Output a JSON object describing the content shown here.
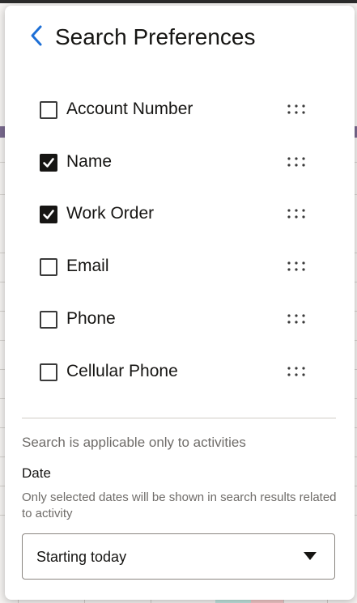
{
  "panel": {
    "title": "Search Preferences",
    "accent_color": "#1d6fd6"
  },
  "fields": [
    {
      "label": "Account Number",
      "checked": false
    },
    {
      "label": "Name",
      "checked": true
    },
    {
      "label": "Work Order",
      "checked": true
    },
    {
      "label": "Email",
      "checked": false
    },
    {
      "label": "Phone",
      "checked": false
    },
    {
      "label": "Cellular Phone",
      "checked": false
    }
  ],
  "activity_note": "Search is applicable only to activities",
  "date": {
    "label": "Date",
    "help_text": "Only selected dates will be shown in search results related to activity",
    "selected": "Starting today"
  },
  "icons": {
    "back": "chevron-left-icon",
    "drag": "drag-handle-icon",
    "dropdown": "caret-down-icon"
  }
}
